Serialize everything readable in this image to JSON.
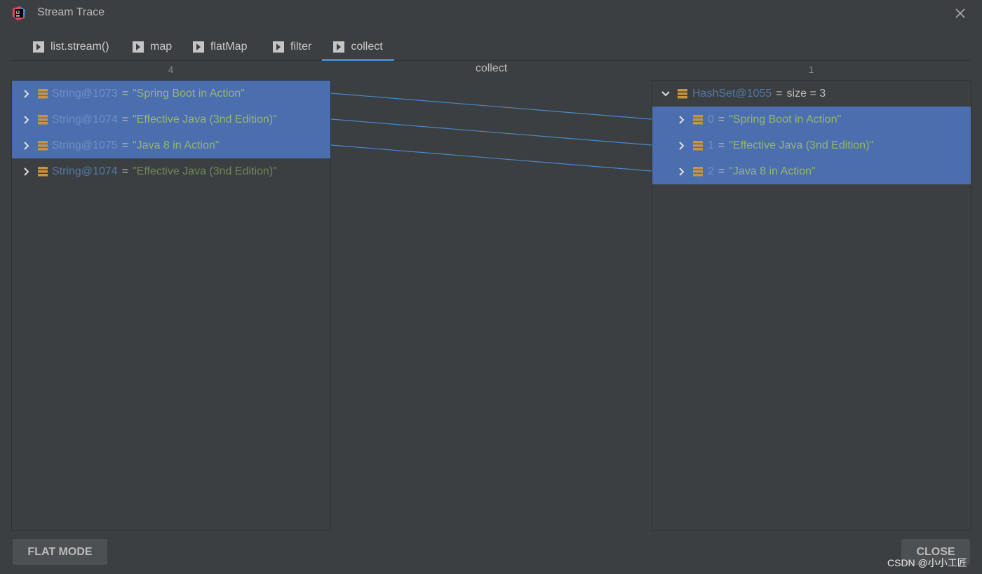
{
  "window": {
    "title": "Stream Trace"
  },
  "tabs": [
    {
      "label": "list.stream()",
      "active": false
    },
    {
      "label": "map",
      "active": false
    },
    {
      "label": "flatMap",
      "active": false
    },
    {
      "label": "filter",
      "active": false
    },
    {
      "label": "collect",
      "active": true
    }
  ],
  "header": {
    "left_count": "4",
    "center_title": "collect",
    "right_count": "1"
  },
  "left_items": [
    {
      "name": "String@1073",
      "eq": "=",
      "value": "\"Spring Boot in Action\"",
      "selected": true
    },
    {
      "name": "String@1074",
      "eq": "=",
      "value": "\"Effective Java (3nd Edition)\"",
      "selected": true
    },
    {
      "name": "String@1075",
      "eq": "=",
      "value": "\"Java 8 in Action\"",
      "selected": true
    },
    {
      "name": "String@1074",
      "eq": "=",
      "value": "\"Effective Java (3nd Edition)\"",
      "selected": false
    }
  ],
  "right_root": {
    "name": "HashSet@1055",
    "eq": "=",
    "value": "size = 3"
  },
  "right_items": [
    {
      "name": "0",
      "eq": "=",
      "value": "\"Spring Boot in Action\"",
      "selected": true
    },
    {
      "name": "1",
      "eq": "=",
      "value": "\"Effective Java (3nd Edition)\"",
      "selected": true
    },
    {
      "name": "2",
      "eq": "=",
      "value": "\"Java 8 in Action\"",
      "selected": true
    }
  ],
  "buttons": {
    "flat_mode": "FLAT MODE",
    "close": "CLOSE"
  },
  "watermark": "CSDN @小小工匠",
  "colors": {
    "accent": "#4a88c7",
    "selection": "#4b6eaf",
    "background": "#3c3f41",
    "field_icon": "#c9953c"
  }
}
